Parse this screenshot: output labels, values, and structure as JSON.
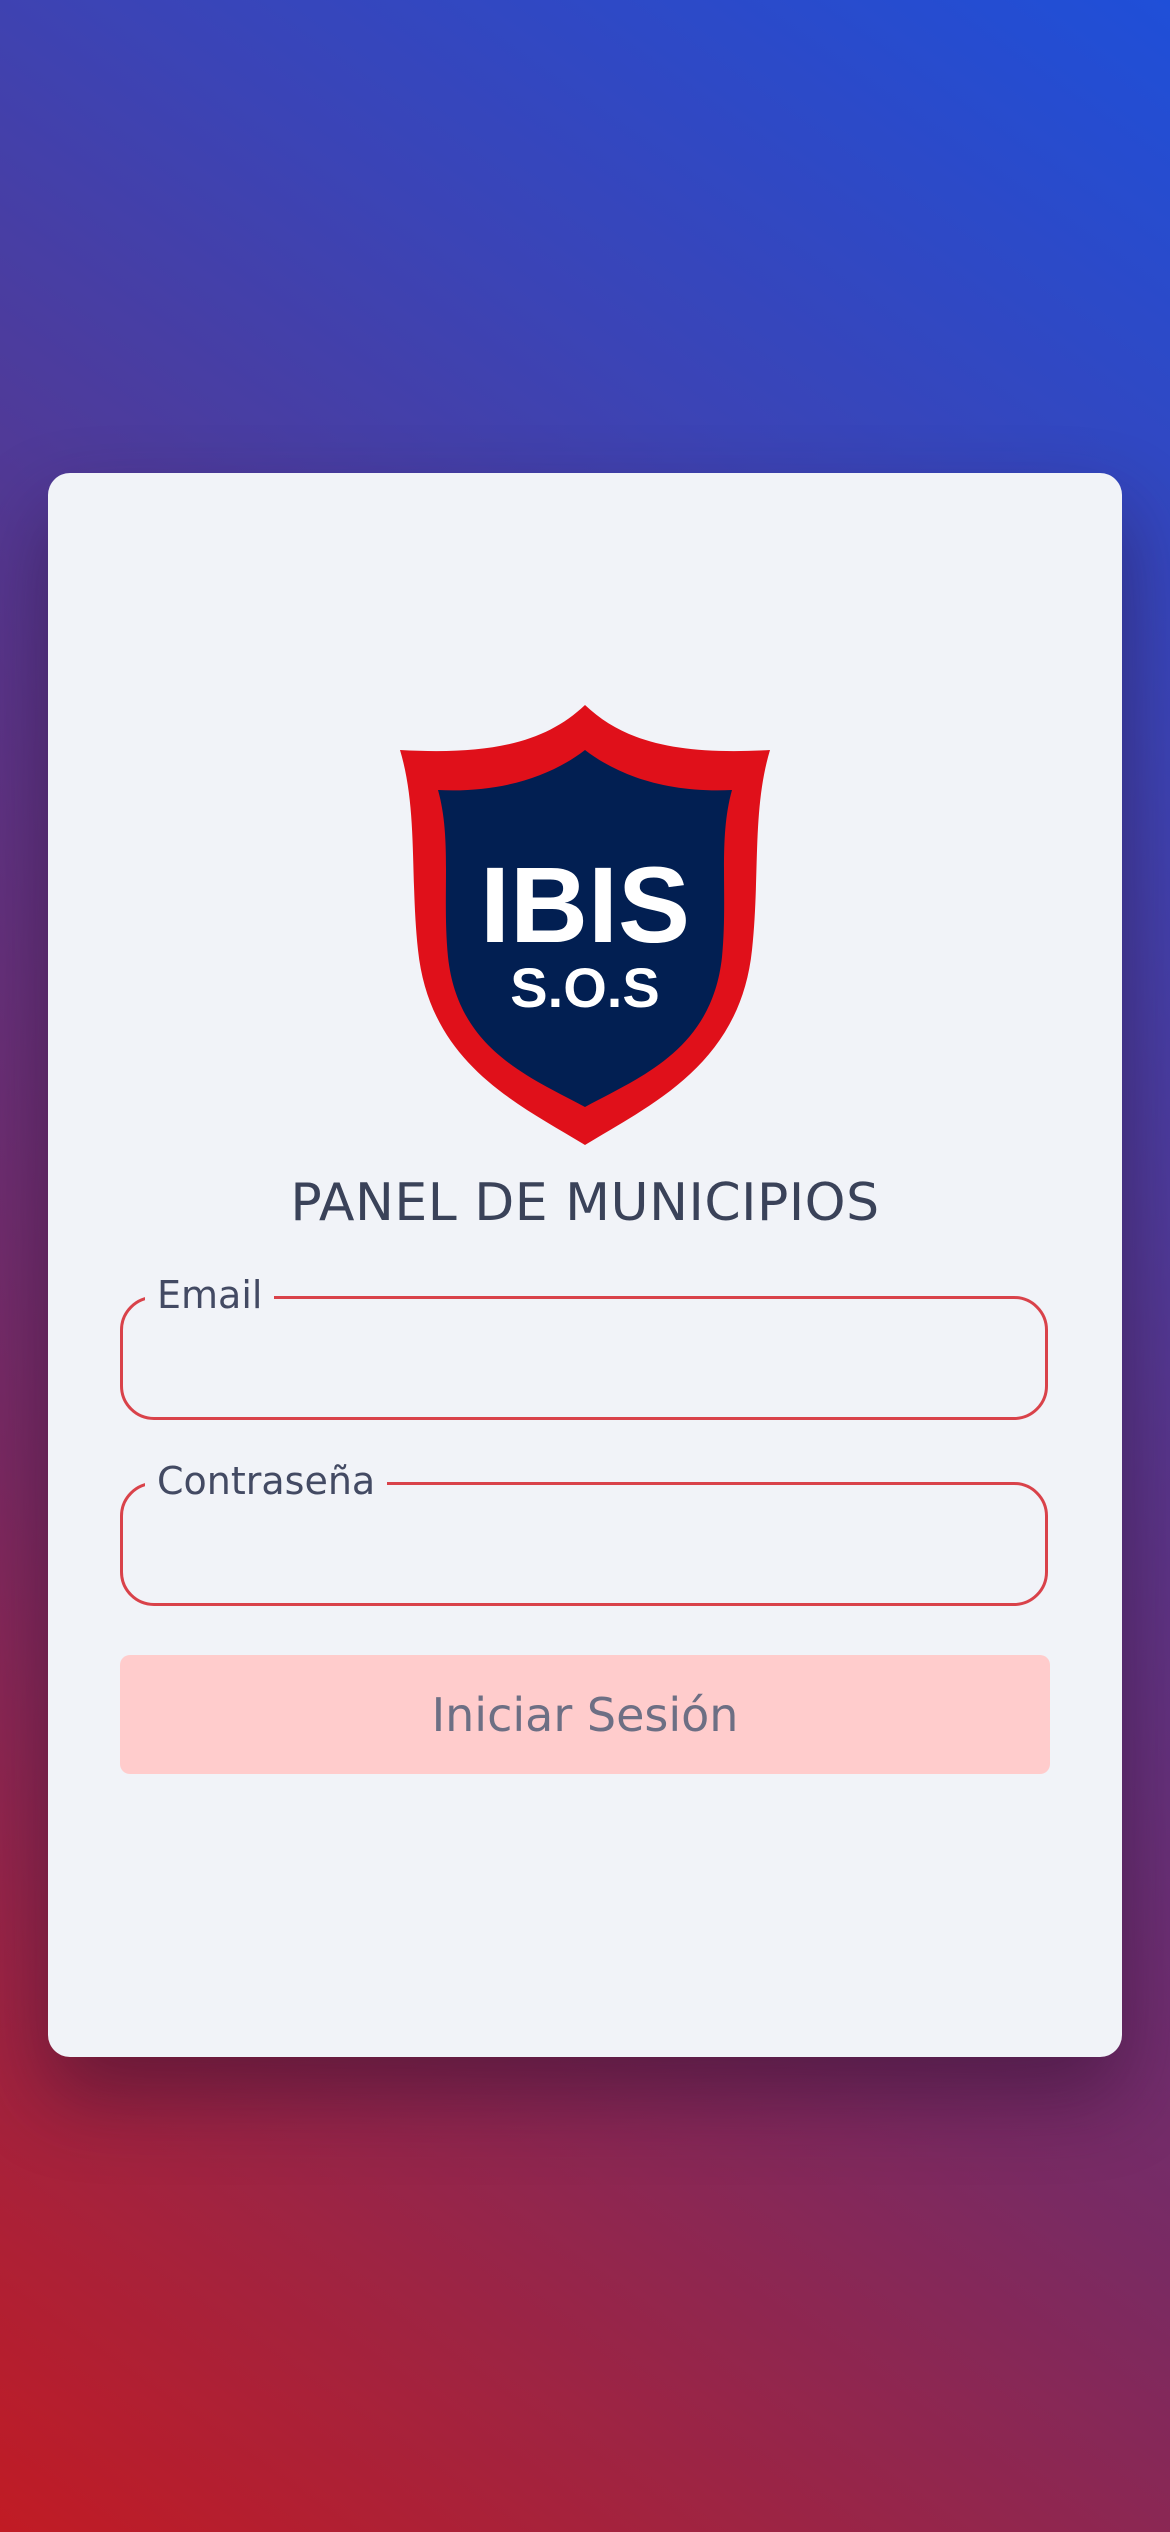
{
  "logo": {
    "text_main": "IBIS",
    "text_sub": "S.O.S",
    "colors": {
      "shield_outer": "#e0101a",
      "shield_inner": "#021f52",
      "text": "#ffffff"
    }
  },
  "panel": {
    "title": "PANEL DE MUNICIPIOS"
  },
  "form": {
    "email": {
      "label": "Email",
      "value": ""
    },
    "password": {
      "label": "Contraseña",
      "value": ""
    },
    "submit_label": "Iniciar Sesión"
  },
  "colors": {
    "field_border": "#d9424a",
    "button_bg": "#ffcccc",
    "button_text": "#6d6f84",
    "card_bg": "#f1f3f8"
  }
}
